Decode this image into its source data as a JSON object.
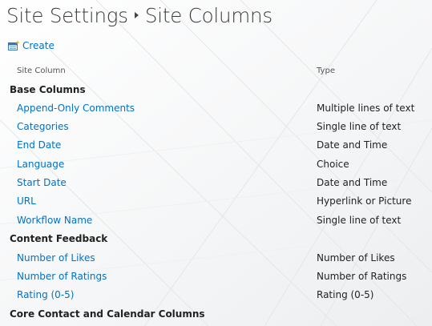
{
  "page": {
    "title_part1": "Site Settings",
    "title_part2": "Site Columns"
  },
  "toolbar": {
    "create_label": "Create"
  },
  "columns_header": {
    "name": "Site Column",
    "type": "Type"
  },
  "groups": [
    {
      "label": "Base Columns",
      "items": [
        {
          "name": "Append-Only Comments",
          "type": "Multiple lines of text"
        },
        {
          "name": "Categories",
          "type": "Single line of text"
        },
        {
          "name": "End Date",
          "type": "Date and Time"
        },
        {
          "name": "Language",
          "type": "Choice"
        },
        {
          "name": "Start Date",
          "type": "Date and Time"
        },
        {
          "name": "URL",
          "type": "Hyperlink or Picture"
        },
        {
          "name": "Workflow Name",
          "type": "Single line of text"
        }
      ]
    },
    {
      "label": "Content Feedback",
      "items": [
        {
          "name": "Number of Likes",
          "type": "Number of Likes"
        },
        {
          "name": "Number of Ratings",
          "type": "Number of Ratings"
        },
        {
          "name": "Rating (0-5)",
          "type": "Rating (0-5)"
        }
      ]
    },
    {
      "label": "Core Contact and Calendar Columns",
      "items": []
    }
  ],
  "colors": {
    "link": "#0072c6",
    "text": "#222222",
    "title": "#3b3b3b"
  }
}
